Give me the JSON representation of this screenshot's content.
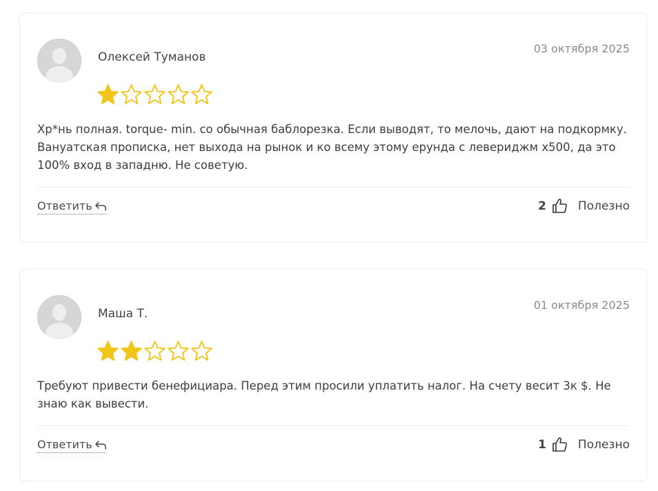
{
  "reviews": [
    {
      "author": "Олексей Туманов",
      "date": "03 октября 2025",
      "rating": 1,
      "max_rating": 5,
      "text": "Хр*нь полная. torque- min. со обычная баблорезка. Если выводят, то мелочь, дают на подкормку. Вануатская прописка, нет выхода на рынок и ко всему этому ерунда с левериджм х500, да это 100% вход в западню. Не советую.",
      "reply_label": "Ответить",
      "helpful_count": "2",
      "helpful_label": "Полезно"
    },
    {
      "author": "Маша Т.",
      "date": "01 октября 2025",
      "rating": 2,
      "max_rating": 5,
      "text": "Требуют привести бенефициара. Перед этим просили уплатить налог. На счету весит 3к $. Не знаю как вывести.",
      "reply_label": "Ответить",
      "helpful_count": "1",
      "helpful_label": "Полезно"
    }
  ],
  "colors": {
    "star_filled": "#F2C51B",
    "star_outline": "#F2C51B"
  },
  "icons": {
    "reply": "reply-arrow-icon",
    "helpful": "thumbs-up-icon",
    "star": "star-icon",
    "avatar": "user-avatar-placeholder"
  }
}
